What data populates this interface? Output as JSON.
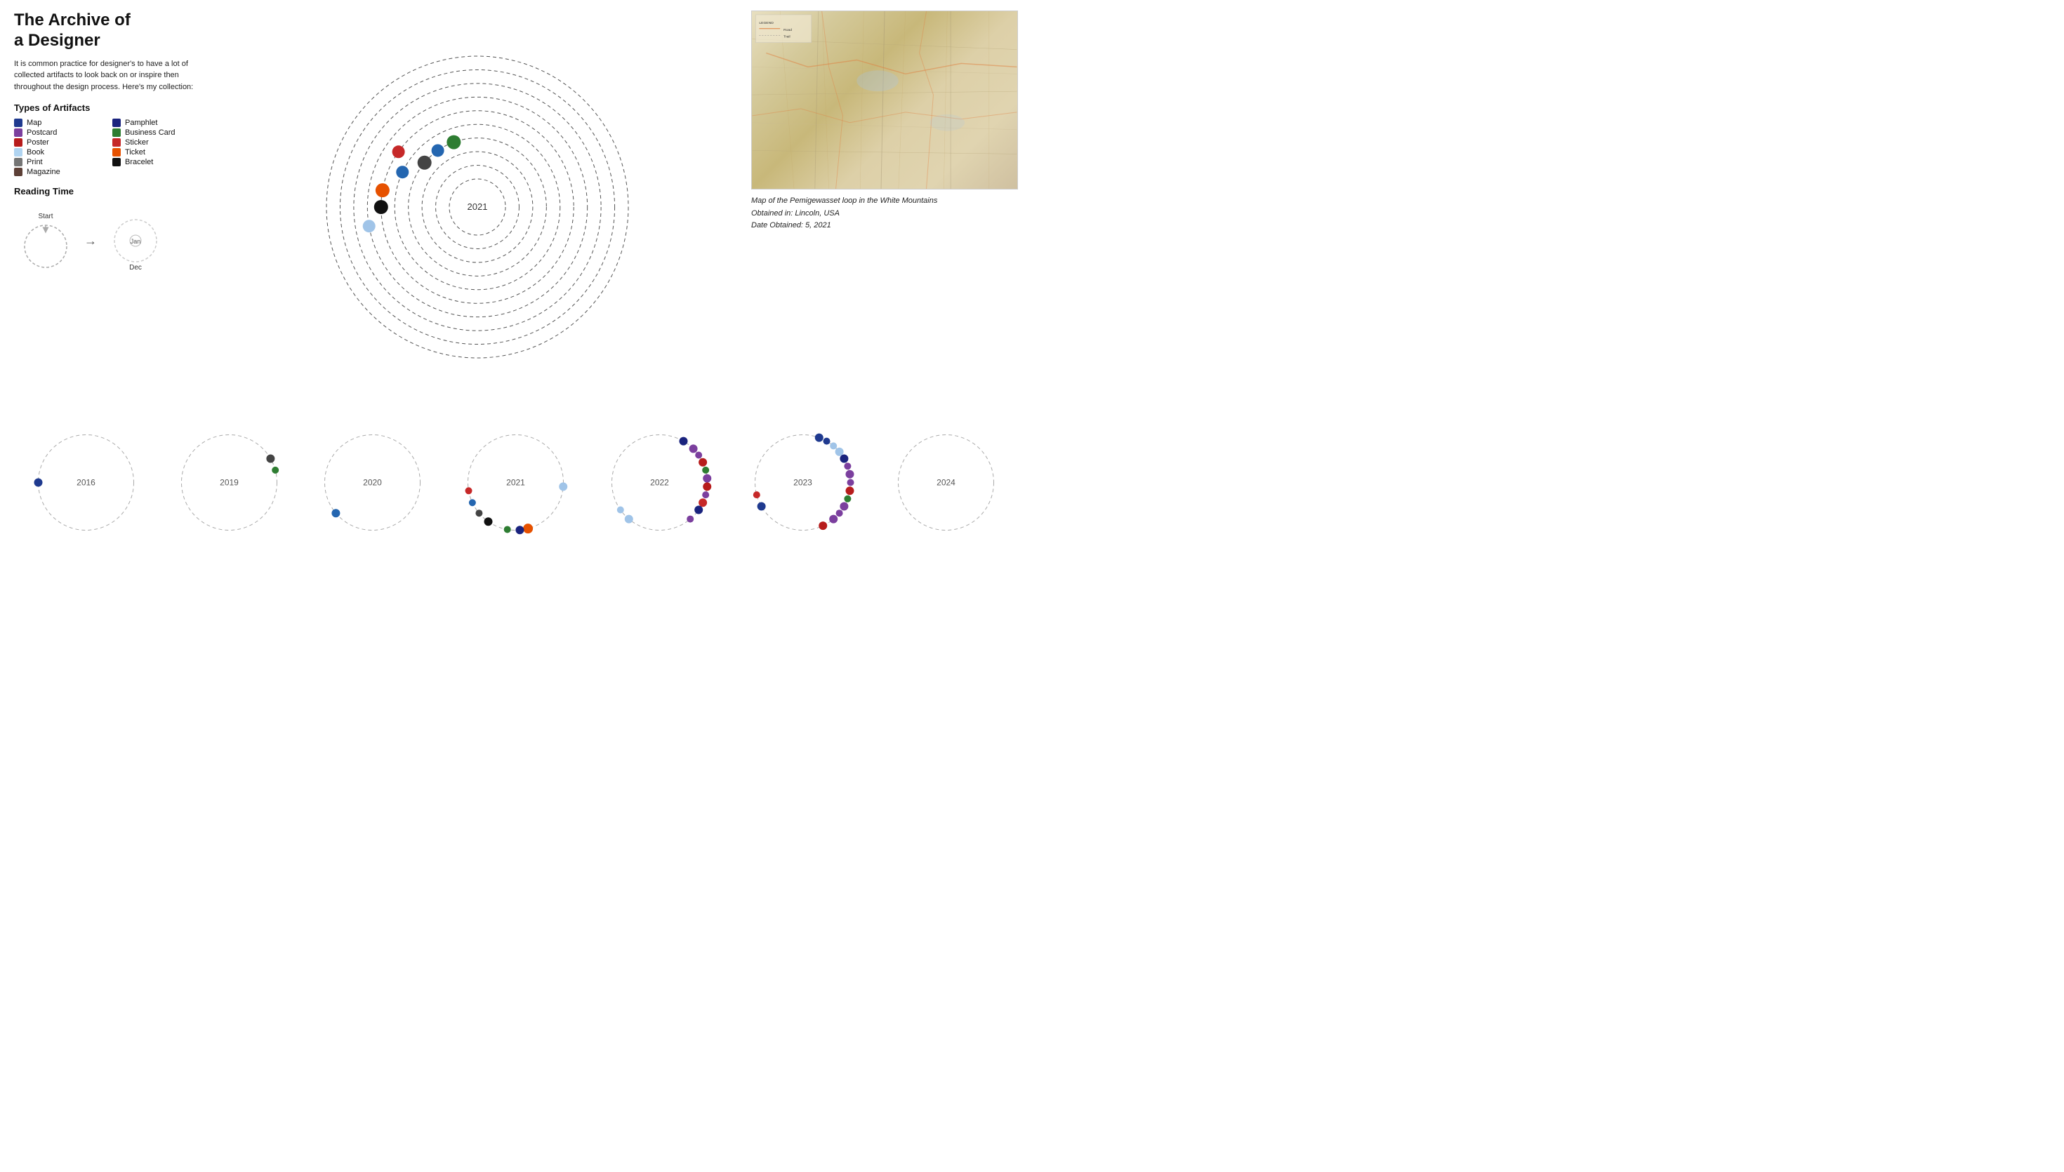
{
  "title": "The Archive of\na Designer",
  "description": "It is common practice for designer's to have a lot of collected artifacts to look back on or inspire then throughout the design process. Here's my collection:",
  "artifacts_heading": "Types of Artifacts",
  "legend": [
    {
      "label": "Map",
      "color": "#1f3a8f"
    },
    {
      "label": "Pamphlet",
      "color": "#1a237e"
    },
    {
      "label": "Postcard",
      "color": "#7b3f9e"
    },
    {
      "label": "Business Card",
      "color": "#2e7d32"
    },
    {
      "label": "Poster",
      "color": "#b71c1c"
    },
    {
      "label": "Sticker",
      "color": "#c62828"
    },
    {
      "label": "Book",
      "color": "#b0d4f1"
    },
    {
      "label": "Ticket",
      "color": "#e65100"
    },
    {
      "label": "Print",
      "color": "#757575"
    },
    {
      "label": "Bracelet",
      "color": "#111111"
    },
    {
      "label": "Magazine",
      "color": "#5d4037"
    }
  ],
  "reading_time_label": "Reading Time",
  "reading_time_start": "Start",
  "reading_time_jan": "Jan",
  "reading_time_dec": "Dec",
  "map_caption_line1": "Map of the Pemigewasset loop in the White Mountains",
  "map_caption_line2": "Obtained in: Lincoln, USA",
  "map_caption_line3": "Date Obtained: 5, 2021",
  "year_circles": [
    {
      "year": "2016",
      "dots": [
        {
          "angle": 270,
          "color": "#1f3a8f",
          "r": 6
        }
      ]
    },
    {
      "year": "2019",
      "dots": [
        {
          "angle": 60,
          "color": "#444444",
          "r": 6
        },
        {
          "angle": 75,
          "color": "#2e7d32",
          "r": 5
        }
      ]
    },
    {
      "year": "2020",
      "dots": [
        {
          "angle": 230,
          "color": "#2466b0",
          "r": 6
        }
      ]
    },
    {
      "year": "2021",
      "dots": [
        {
          "angle": 95,
          "color": "#a0c4e8",
          "r": 6
        },
        {
          "angle": 165,
          "color": "#e65100",
          "r": 7
        },
        {
          "angle": 175,
          "color": "#1a237e",
          "r": 6
        },
        {
          "angle": 190,
          "color": "#2e7d32",
          "r": 5
        },
        {
          "angle": 215,
          "color": "#111",
          "r": 6
        },
        {
          "angle": 245,
          "color": "#2466b0",
          "r": 5
        },
        {
          "angle": 260,
          "color": "#c62828",
          "r": 5
        },
        {
          "angle": 230,
          "color": "#444",
          "r": 5
        }
      ]
    },
    {
      "year": "2022",
      "dots": [
        {
          "angle": 30,
          "color": "#1a237e",
          "r": 6
        },
        {
          "angle": 45,
          "color": "#7b3f9e",
          "r": 6
        },
        {
          "angle": 55,
          "color": "#7b3f9e",
          "r": 5
        },
        {
          "angle": 65,
          "color": "#b71c1c",
          "r": 6
        },
        {
          "angle": 75,
          "color": "#2e7d32",
          "r": 5
        },
        {
          "angle": 85,
          "color": "#7b3f9e",
          "r": 6
        },
        {
          "angle": 95,
          "color": "#b71c1c",
          "r": 6
        },
        {
          "angle": 105,
          "color": "#7b3f9e",
          "r": 5
        },
        {
          "angle": 115,
          "color": "#c62828",
          "r": 6
        },
        {
          "angle": 125,
          "color": "#1a237e",
          "r": 6
        },
        {
          "angle": 140,
          "color": "#7b3f9e",
          "r": 5
        },
        {
          "angle": 220,
          "color": "#a0c4e8",
          "r": 6
        },
        {
          "angle": 235,
          "color": "#a0c4e8",
          "r": 5
        }
      ]
    },
    {
      "year": "2023",
      "dots": [
        {
          "angle": 20,
          "color": "#1f3a8f",
          "r": 6
        },
        {
          "angle": 30,
          "color": "#1f3a8f",
          "r": 5
        },
        {
          "angle": 40,
          "color": "#a0c4e8",
          "r": 5
        },
        {
          "angle": 50,
          "color": "#a0c4e8",
          "r": 6
        },
        {
          "angle": 60,
          "color": "#1a237e",
          "r": 6
        },
        {
          "angle": 70,
          "color": "#7b3f9e",
          "r": 5
        },
        {
          "angle": 80,
          "color": "#7b3f9e",
          "r": 6
        },
        {
          "angle": 90,
          "color": "#7b3f9e",
          "r": 5
        },
        {
          "angle": 100,
          "color": "#b71c1c",
          "r": 6
        },
        {
          "angle": 110,
          "color": "#2e7d32",
          "r": 5
        },
        {
          "angle": 120,
          "color": "#7b3f9e",
          "r": 6
        },
        {
          "angle": 130,
          "color": "#7b3f9e",
          "r": 5
        },
        {
          "angle": 140,
          "color": "#7b3f9e",
          "r": 6
        },
        {
          "angle": 155,
          "color": "#b71c1c",
          "r": 6
        },
        {
          "angle": 240,
          "color": "#1f3a8f",
          "r": 6
        },
        {
          "angle": 255,
          "color": "#c62828",
          "r": 5
        }
      ]
    },
    {
      "year": "2024",
      "dots": []
    }
  ],
  "spiral_dots": [
    {
      "ring": 3,
      "angle": 310,
      "color": "#444444",
      "r": 10
    },
    {
      "ring": 3,
      "angle": 325,
      "color": "#2466b0",
      "r": 9
    },
    {
      "ring": 3,
      "angle": 340,
      "color": "#2e7d32",
      "r": 10
    },
    {
      "ring": 4,
      "angle": 295,
      "color": "#2466b0",
      "r": 9
    },
    {
      "ring": 5,
      "angle": 280,
      "color": "#e65100",
      "r": 10
    },
    {
      "ring": 5,
      "angle": 305,
      "color": "#c62828",
      "r": 9
    },
    {
      "ring": 6,
      "angle": 260,
      "color": "#a0c4e8",
      "r": 9
    },
    {
      "ring": 5,
      "angle": 270,
      "color": "#111111",
      "r": 10
    }
  ]
}
